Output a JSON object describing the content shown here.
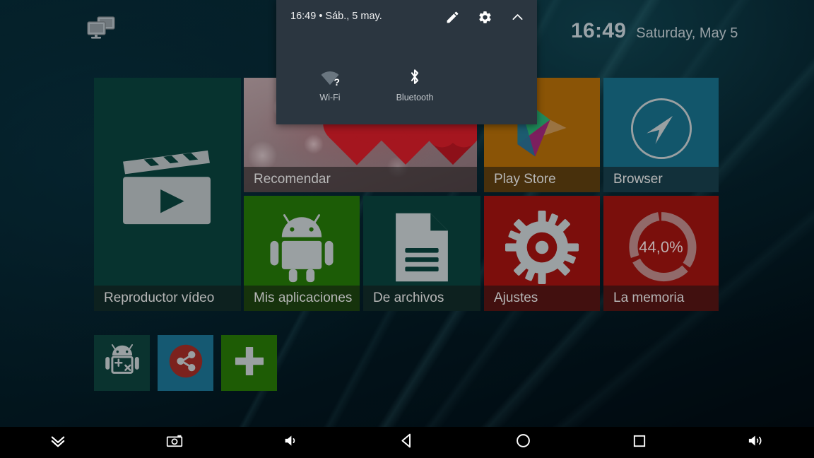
{
  "wallpaper": {
    "name": "teal-light-rays-wallpaper"
  },
  "status_icon": {
    "name": "network-computers-icon"
  },
  "clock_widget": {
    "time": "16:49",
    "date": "Saturday, May 5"
  },
  "quick_settings": {
    "status_text": "16:49  •  Sáb., 5 may.",
    "actions": [
      {
        "name": "edit-icon",
        "label": "Edit"
      },
      {
        "name": "gear-icon",
        "label": "Settings"
      },
      {
        "name": "chevron-up-icon",
        "label": "Collapse"
      }
    ],
    "tiles": [
      {
        "label": "Wi-Fi",
        "icon": "wifi-question-icon",
        "state": "unknown"
      },
      {
        "label": "Bluetooth",
        "icon": "bluetooth-icon",
        "state": "on"
      }
    ],
    "panel_color": "#2b3640"
  },
  "tiles": [
    {
      "label": "Reproductor vídeo",
      "icon": "clapperboard-play-icon",
      "color": "#07332f"
    },
    {
      "label": "Recomendar",
      "icon": "hearts-photo",
      "color": "#6b5a5e"
    },
    {
      "label": "Play Store",
      "icon": "play-store-icon",
      "color": "#8a5406"
    },
    {
      "label": "Browser",
      "icon": "compass-arrow-icon",
      "color": "#12566b"
    },
    {
      "label": "Mis aplicaciones",
      "icon": "android-robot-icon",
      "color": "#1c5c06"
    },
    {
      "label": "De archivos",
      "icon": "document-lines-icon",
      "color": "#07332f"
    },
    {
      "label": "Ajustes",
      "icon": "gear-icon",
      "color": "#7c0e0c"
    },
    {
      "label": "La memoria",
      "icon": "circular-gauge-icon",
      "color": "#7a0f0c",
      "value": "44,0%"
    }
  ],
  "shortcuts": [
    {
      "name": "android-calculator-shortcut",
      "icon": "android-plus-times-icon",
      "color": "#0a332f"
    },
    {
      "name": "share-shortcut",
      "icon": "share-icon",
      "color": "#155972"
    },
    {
      "name": "add-shortcut",
      "icon": "plus-icon",
      "color": "#1e5c05"
    }
  ],
  "navbar": [
    {
      "name": "notifications-pulldown-button",
      "icon": "double-chevron-down-icon"
    },
    {
      "name": "screenshot-button",
      "icon": "camera-icon"
    },
    {
      "name": "volume-down-button",
      "icon": "speaker-low-icon"
    },
    {
      "name": "back-button",
      "icon": "triangle-back-icon"
    },
    {
      "name": "home-button",
      "icon": "circle-home-icon"
    },
    {
      "name": "recents-button",
      "icon": "square-recents-icon"
    },
    {
      "name": "volume-up-button",
      "icon": "speaker-high-icon"
    }
  ]
}
